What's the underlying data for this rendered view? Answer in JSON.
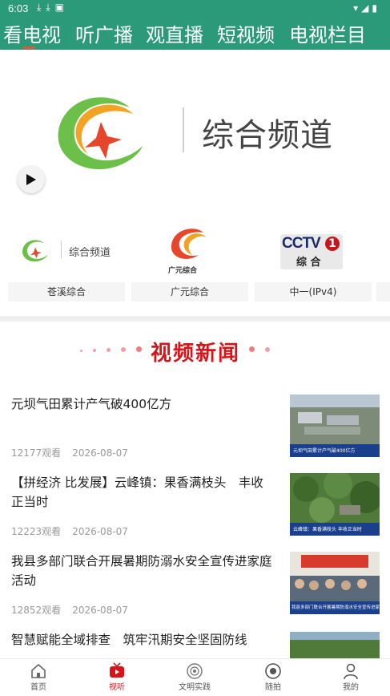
{
  "status": {
    "time": "6:03",
    "left_icons": [
      "download-icon",
      "download-icon",
      "a-icon"
    ],
    "right_icons": [
      "wifi-icon",
      "signal-icon",
      "battery-icon"
    ]
  },
  "top_nav": {
    "tabs": [
      {
        "label": "看电视",
        "active": true
      },
      {
        "label": "听广播",
        "active": false
      },
      {
        "label": "观直播",
        "active": false
      },
      {
        "label": "短视频",
        "active": false
      },
      {
        "label": "电视栏目",
        "active": false
      }
    ],
    "accent": "#2a9a78",
    "indicator_color": "#e0553a"
  },
  "hero": {
    "title": "综合频道"
  },
  "channels": [
    {
      "logo_text": "综合频道",
      "label": "苍溪综合"
    },
    {
      "logo_text": "广元综合",
      "label": "广元综合"
    },
    {
      "logo_text_top": "CCTV",
      "logo_text_num": "1",
      "logo_text_bottom": "综 合",
      "label": "中一(IPv4)"
    }
  ],
  "section": {
    "title": "视频新闻",
    "title_color": "#d8141b"
  },
  "news": [
    {
      "title": "元坝气田累计产气破400亿方",
      "views": "12177观看",
      "date": "2026-08-07",
      "thumb_caption": "元坝气田累计产气破400亿方"
    },
    {
      "title": "【拼经济 比发展】云峰镇：果香满枝头　丰收正当时",
      "views": "12223观看",
      "date": "2026-08-07",
      "thumb_caption": "云峰镇：果香满枝头 丰收正当时"
    },
    {
      "title": "我县多部门联合开展暑期防溺水安全宣传进家庭活动",
      "views": "12852观看",
      "date": "2026-08-07",
      "thumb_caption": "我县多部门联合开展暑期防溺水安全宣传进家庭活动"
    },
    {
      "title": "智慧赋能全域排查　筑牢汛期安全坚固防线",
      "views": "",
      "date": "",
      "thumb_caption": ""
    }
  ],
  "tab_bar": [
    {
      "label": "首页",
      "icon": "home-icon",
      "active": false
    },
    {
      "label": "视听",
      "icon": "tv-icon",
      "active": true
    },
    {
      "label": "文明实践",
      "icon": "emblem-icon",
      "active": false
    },
    {
      "label": "随拍",
      "icon": "camera-icon",
      "active": false
    },
    {
      "label": "我的",
      "icon": "user-icon",
      "active": false
    }
  ]
}
